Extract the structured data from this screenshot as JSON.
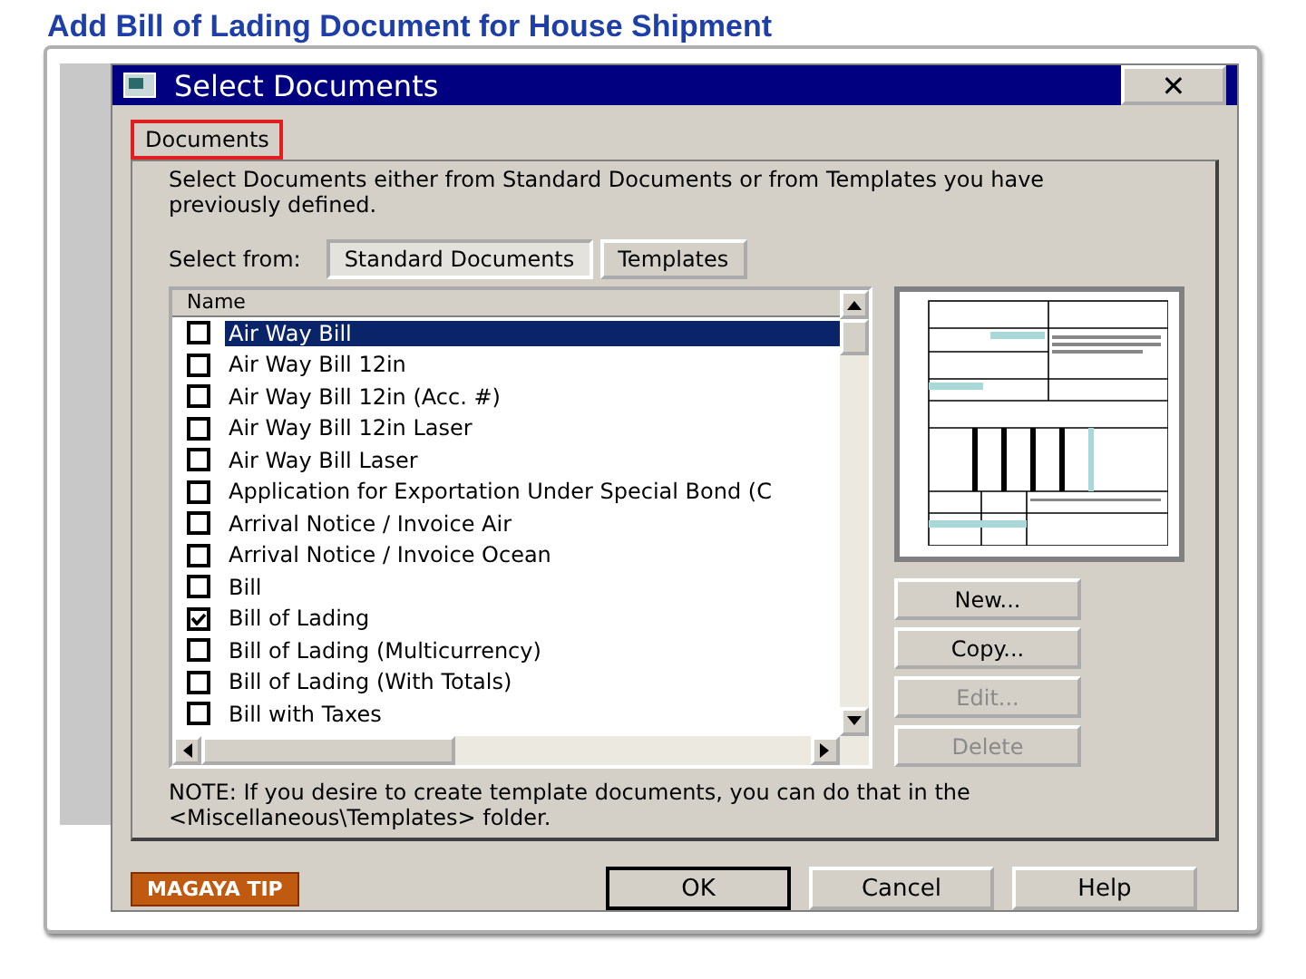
{
  "slide_title": "Add Bill of Lading Document for House Shipment",
  "window": {
    "title": "Select Documents",
    "close": "✕"
  },
  "group": {
    "label": "Documents",
    "highlighted": true
  },
  "intro": "Select Documents either from Standard Documents or from Templates you have previously defined.",
  "select_from": {
    "label": "Select from:",
    "tabs": [
      {
        "label": "Standard Documents",
        "selected": true
      },
      {
        "label": "Templates",
        "selected": false
      }
    ]
  },
  "list": {
    "column": "Name",
    "rows": [
      {
        "name": "Air Way Bill",
        "checked": false,
        "selected": true
      },
      {
        "name": "Air Way Bill 12in",
        "checked": false,
        "selected": false
      },
      {
        "name": "Air Way Bill 12in (Acc. #)",
        "checked": false,
        "selected": false
      },
      {
        "name": "Air Way Bill 12in Laser",
        "checked": false,
        "selected": false
      },
      {
        "name": "Air Way Bill Laser",
        "checked": false,
        "selected": false
      },
      {
        "name": "Application for Exportation Under Special Bond (C",
        "checked": false,
        "selected": false
      },
      {
        "name": "Arrival Notice / Invoice Air",
        "checked": false,
        "selected": false
      },
      {
        "name": "Arrival Notice / Invoice Ocean",
        "checked": false,
        "selected": false
      },
      {
        "name": "Bill",
        "checked": false,
        "selected": false
      },
      {
        "name": "Bill of Lading",
        "checked": true,
        "selected": false
      },
      {
        "name": "Bill of Lading (Multicurrency)",
        "checked": false,
        "selected": false
      },
      {
        "name": "Bill of Lading (With Totals)",
        "checked": false,
        "selected": false
      },
      {
        "name": "Bill with Taxes",
        "checked": false,
        "selected": false
      }
    ]
  },
  "side_buttons": [
    {
      "label": "New...",
      "disabled": false
    },
    {
      "label": "Copy...",
      "disabled": false
    },
    {
      "label": "Edit...",
      "disabled": true
    },
    {
      "label": "Delete",
      "disabled": true
    }
  ],
  "note": "NOTE: If you desire to create template documents, you can do that in the <Miscellaneous\\Templates> folder.",
  "tip": "MAGAYA TIP",
  "buttons": [
    {
      "label": "OK",
      "default": true
    },
    {
      "label": "Cancel",
      "default": false
    },
    {
      "label": "Help",
      "default": false
    }
  ]
}
